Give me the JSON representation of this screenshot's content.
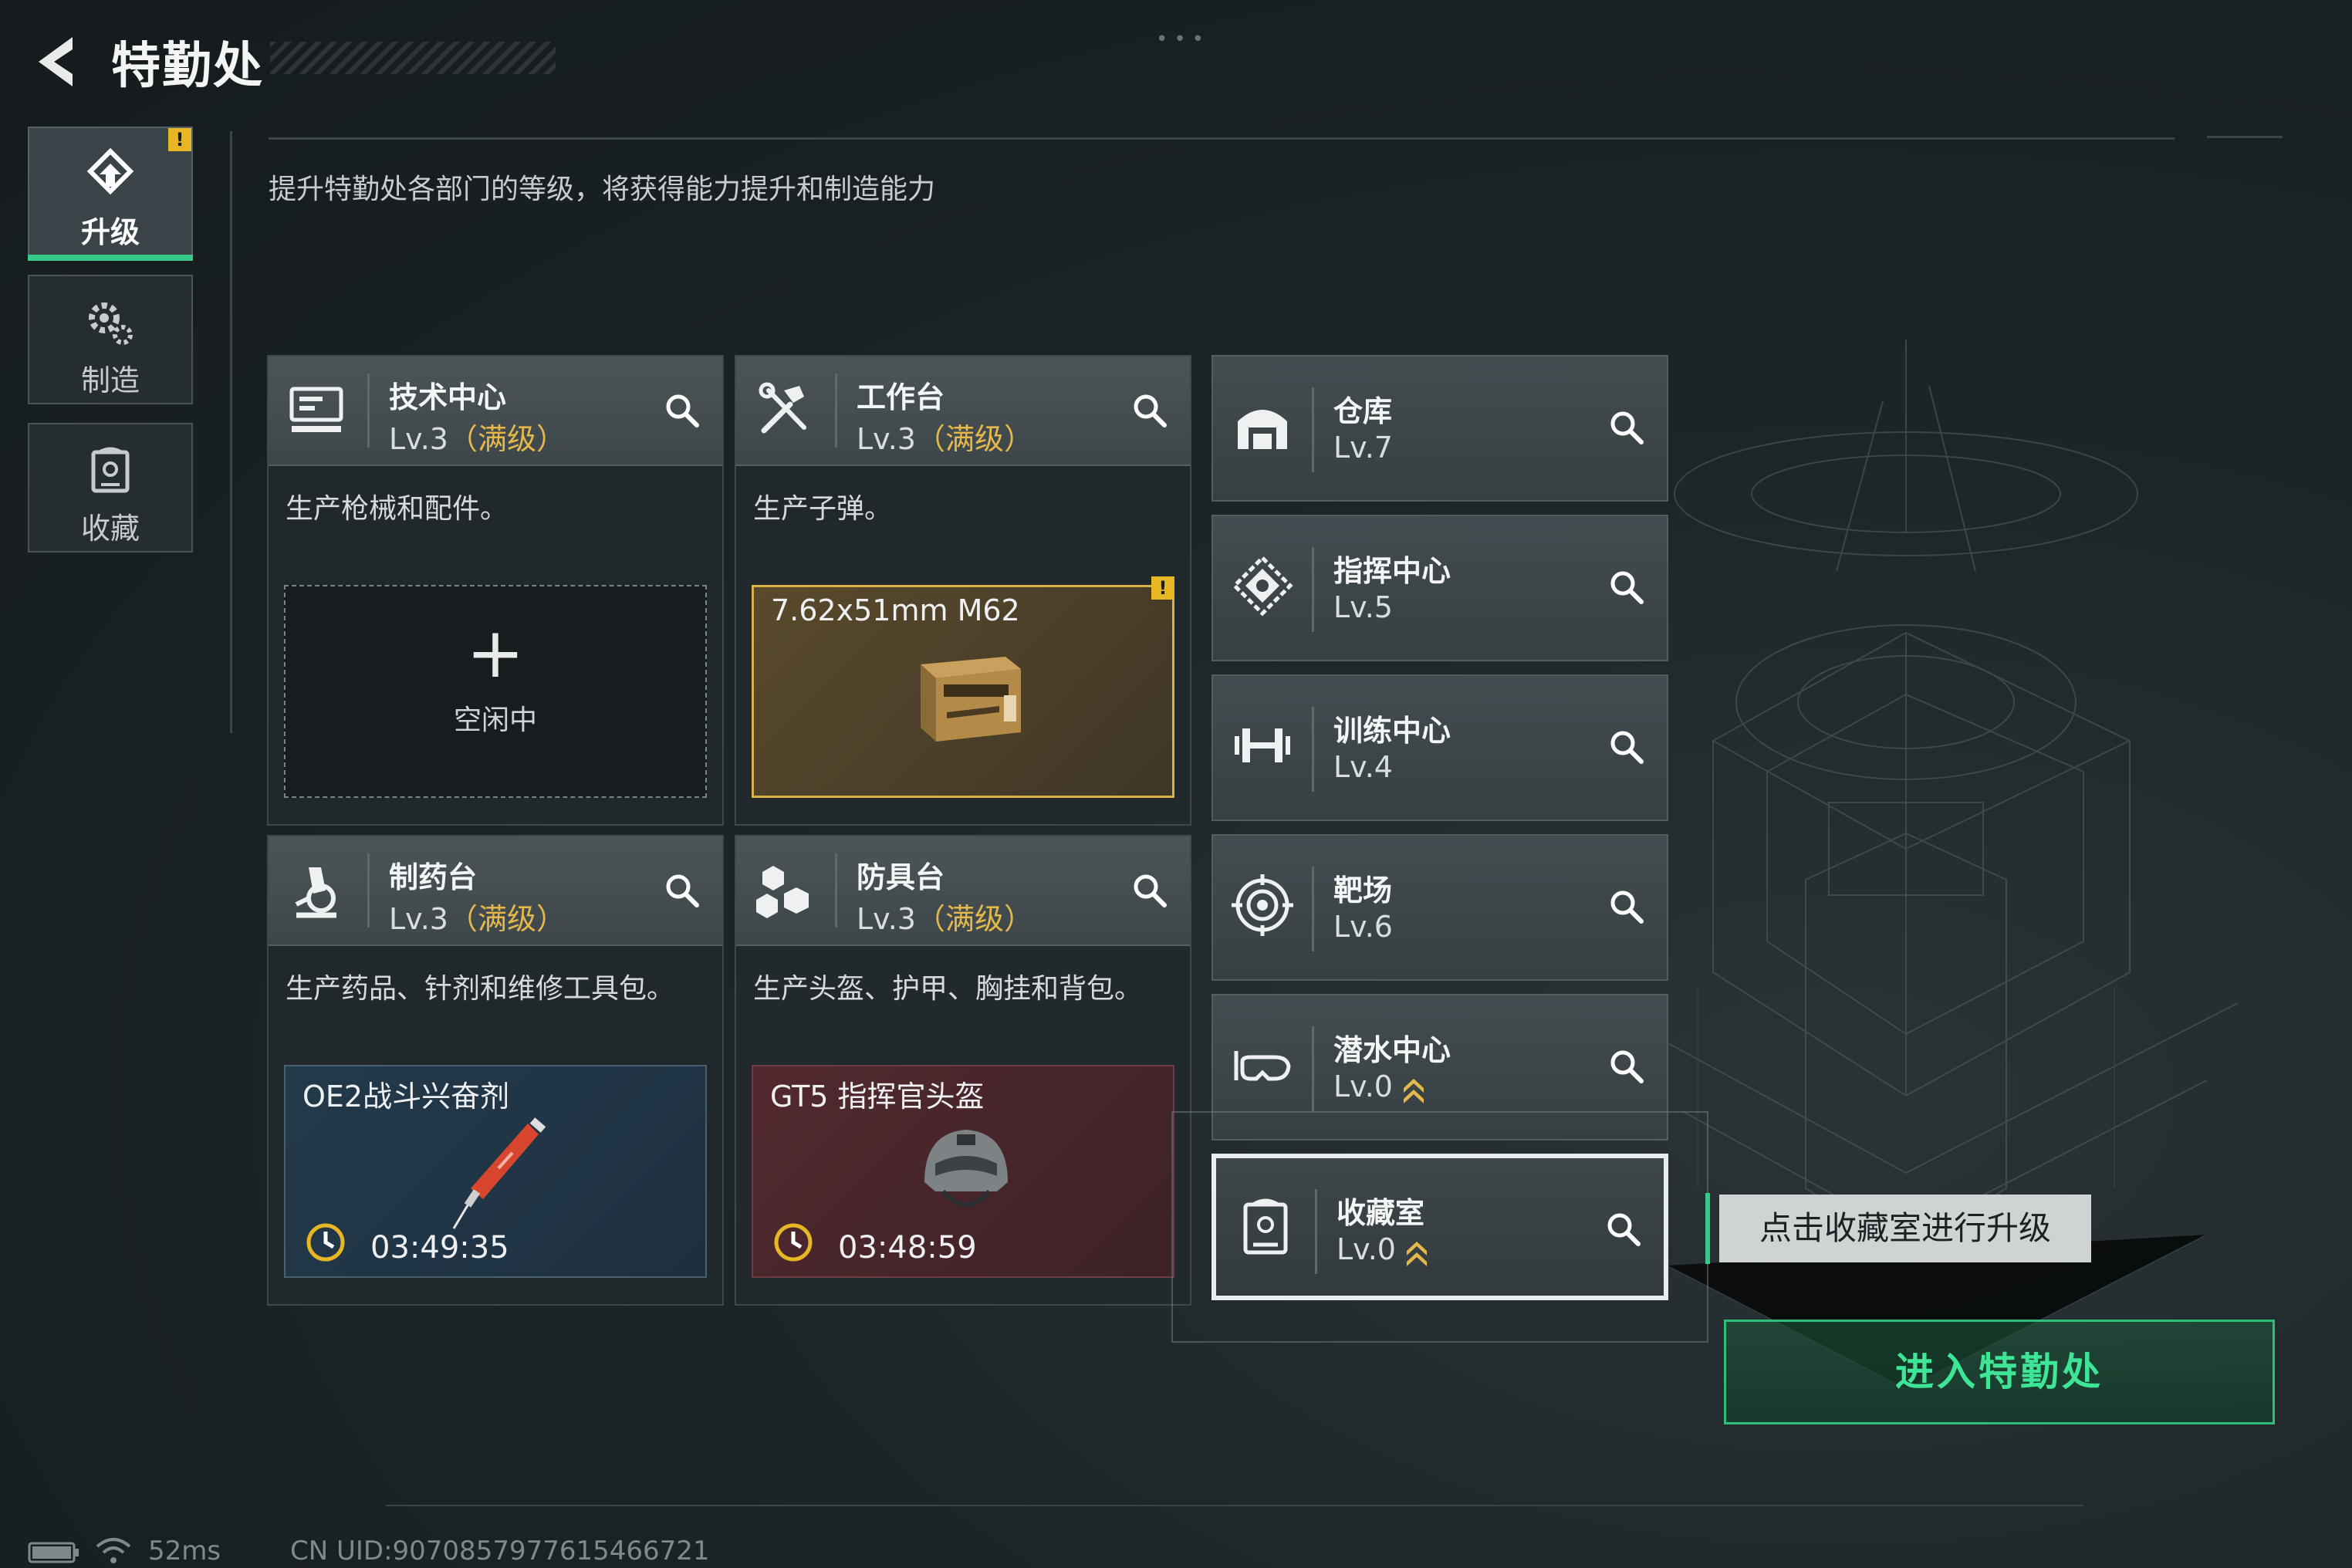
{
  "header": {
    "title": "特勤处"
  },
  "nav": [
    {
      "label": "升级",
      "active": true,
      "alert": "!"
    },
    {
      "label": "制造",
      "active": false
    },
    {
      "label": "收藏",
      "active": false
    }
  ],
  "subtitle": "提升特勤处各部门的等级，将获得能力提升和制造能力",
  "cards": [
    {
      "name": "技术中心",
      "level": "Lv.3",
      "max_label": "（满级）",
      "desc": "生产枪械和配件。",
      "slot": {
        "state": "idle",
        "plus": "+",
        "label": "空闲中"
      }
    },
    {
      "name": "工作台",
      "level": "Lv.3",
      "max_label": "（满级）",
      "desc": "生产子弹。",
      "slot": {
        "state": "done",
        "title": "7.62x51mm M62",
        "alert": "!"
      }
    },
    {
      "name": "制药台",
      "level": "Lv.3",
      "max_label": "（满级）",
      "desc": "生产药品、针剂和维修工具包。",
      "slot": {
        "state": "producing",
        "title": "OE2战斗兴奋剂",
        "time": "03:49:35"
      }
    },
    {
      "name": "防具台",
      "level": "Lv.3",
      "max_label": "（满级）",
      "desc": "生产头盔、护甲、胸挂和背包。",
      "slot": {
        "state": "producing",
        "title": "GT5 指挥官头盔",
        "time": "03:48:59"
      }
    }
  ],
  "buildings": [
    {
      "name": "仓库",
      "level": "Lv.7",
      "icon": "warehouse-icon"
    },
    {
      "name": "指挥中心",
      "level": "Lv.5",
      "icon": "command-icon"
    },
    {
      "name": "训练中心",
      "level": "Lv.4",
      "icon": "dumbbell-icon"
    },
    {
      "name": "靶场",
      "level": "Lv.6",
      "icon": "target-icon"
    },
    {
      "name": "潜水中心",
      "level": "Lv.0",
      "upgradable": true,
      "icon": "diving-mask-icon"
    },
    {
      "name": "收藏室",
      "level": "Lv.0",
      "upgradable": true,
      "selected": true,
      "icon": "collection-icon"
    }
  ],
  "tooltip": "点击收藏室进行升级",
  "enter_button": "进入特勤处",
  "status": {
    "ping": "52ms",
    "uid": "CN UID:9070857977615466721"
  },
  "colors": {
    "accent_green": "#37c98a",
    "gold": "#e4b84a",
    "warning": "#e7b625"
  }
}
